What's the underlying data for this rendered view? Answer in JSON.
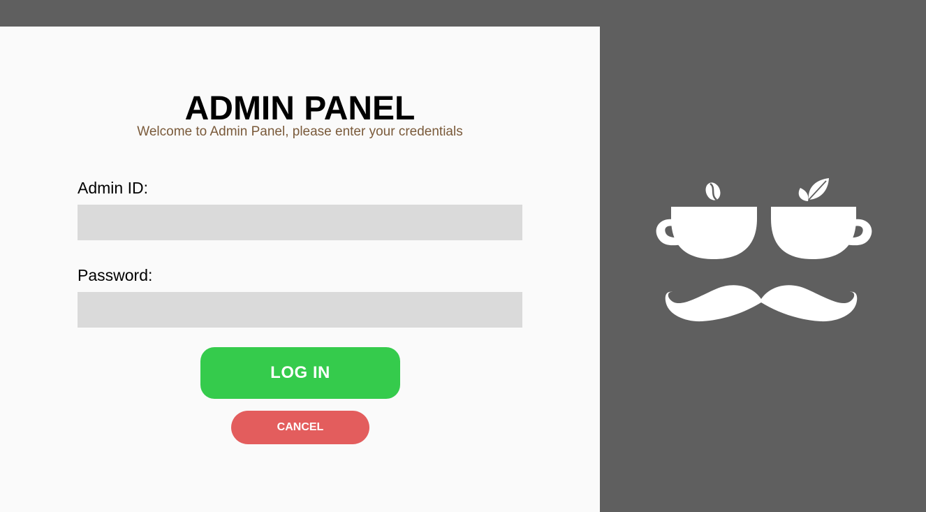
{
  "header": {
    "title": "ADMIN PANEL",
    "subtitle": "Welcome to Admin Panel, please enter your credentials"
  },
  "form": {
    "admin_id_label": "Admin ID:",
    "admin_id_value": "",
    "password_label": "Password:",
    "password_value": ""
  },
  "buttons": {
    "login_label": "LOG IN",
    "cancel_label": "CANCEL"
  },
  "colors": {
    "login_button": "#35cb4c",
    "cancel_button": "#e35d5d",
    "subtitle": "#7a5a3a",
    "side_panel": "#5f5f5f",
    "input_background": "#dadada"
  },
  "logo": {
    "icons": [
      "coffee-cup-icon",
      "coffee-bean-icon",
      "tea-cup-icon",
      "tea-leaf-icon",
      "mustache-icon"
    ]
  }
}
